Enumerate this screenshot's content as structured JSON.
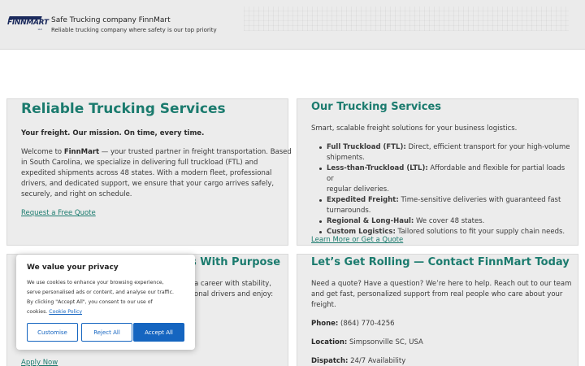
{
  "header": {
    "logo": {
      "text": "FINNMART",
      "suffix": "LLC"
    },
    "site_title": "Safe Trucking company FinnMart",
    "tagline": "Reliable trucking company where safety is our top priority"
  },
  "hero": {
    "title": "Reliable Trucking Services",
    "subtitle": "Your freight. Our mission. On time, every time.",
    "intro_prefix": "Welcome to ",
    "intro_brand": "FinnMart",
    "intro_line1_rest": " — your trusted partner in freight transportation. Based",
    "intro_line2": "in South Carolina, we specialize in delivering full truckload (FTL) and",
    "intro_line3": "expedited shipments across 48 states. With a modern fleet, professional",
    "intro_line4": "drivers, and dedicated support, we ensure that your cargo arrives safely,",
    "intro_line5": "securely, and right on schedule.",
    "cta": "Request a Free Quote"
  },
  "services": {
    "title": "Our Trucking Services",
    "intro": "Smart, scalable freight solutions for your business logistics.",
    "items": [
      {
        "label": "Full Truckload (FTL):",
        "text_line1": " Direct, efficient transport for your high-volume",
        "text_line2": "shipments."
      },
      {
        "label": "Less-than-Truckload (LTL):",
        "text_line1": " Affordable and flexible for partial loads or",
        "text_line2": "regular deliveries."
      },
      {
        "label": "Expedited Freight:",
        "text_line1": " Time-sensitive deliveries with guaranteed fast",
        "text_line2": "turnarounds."
      },
      {
        "label": "Regional & Long-Haul:",
        "text_line1": " We cover 48 states.",
        "text_line2": ""
      },
      {
        "label": "Custom Logistics:",
        "text_line1": " Tailored solutions to fit your supply chain needs.",
        "text_line2": ""
      }
    ],
    "cta": "Learn More or Get a Quote"
  },
  "careers": {
    "title_visible": "s With Purpose",
    "line1_visible": "a career with stability,",
    "line2_visible": "onal drivers and enjoy:",
    "cta": "Apply Now"
  },
  "contact": {
    "title": "Let’s Get Rolling — Contact FinnMart Today",
    "intro_line1": "Need a quote? Have a question? We’re here to help. Reach out to our team",
    "intro_line2": "and get fast, personalized support from real people who care about your",
    "intro_line3": "freight.",
    "phone_label": "Phone:",
    "phone": " (864) 770-4256",
    "location_label": "Location:",
    "location": " Simpsonville SC, USA",
    "dispatch_label": "Dispatch:",
    "dispatch": " 24/7 Availability"
  },
  "cookie_banner": {
    "title": "We value your privacy",
    "body_line1": "We use cookies to enhance your browsing experience,",
    "body_line2": "serve personalised ads or content, and analyse our traffic.",
    "body_line3": "By clicking \"Accept All\", you consent to our use of",
    "body_line4_prefix": "cookies. ",
    "policy_link": "Cookie Policy",
    "customise": "Customise",
    "reject": "Reject All",
    "accept": "Accept All"
  }
}
